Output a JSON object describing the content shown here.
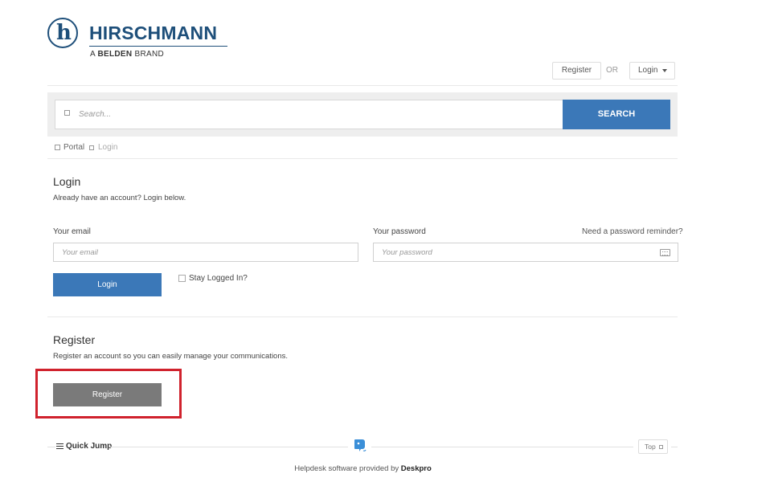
{
  "brand": {
    "logo_letter": "h",
    "name": "HIRSCHMANN",
    "tagline_prefix": "A ",
    "tagline_bold": "BELDEN",
    "tagline_suffix": " BRAND"
  },
  "header": {
    "register_label": "Register",
    "or_label": "OR",
    "login_label": "Login"
  },
  "search": {
    "placeholder": "Search...",
    "button_label": "SEARCH"
  },
  "breadcrumb": {
    "items": [
      "Portal",
      "Login"
    ]
  },
  "login": {
    "title": "Login",
    "description": "Already have an account? Login below.",
    "email_label": "Your email",
    "email_placeholder": "Your email",
    "password_label": "Your password",
    "password_placeholder": "Your password",
    "reminder_link": "Need a password reminder?",
    "submit_label": "Login",
    "stay_logged_in_label": "Stay Logged In?"
  },
  "register": {
    "title": "Register",
    "description": "Register an account so you can easily manage your communications.",
    "button_label": "Register"
  },
  "footer": {
    "quick_jump_label": "Quick Jump",
    "top_label": "Top",
    "provided_by_prefix": "Helpdesk software provided by ",
    "provided_by_brand": "Deskpro"
  },
  "colors": {
    "brand_blue": "#1e4f7a",
    "primary_button": "#3b78b8",
    "register_button": "#7a7a7a",
    "highlight": "#d0222d"
  }
}
